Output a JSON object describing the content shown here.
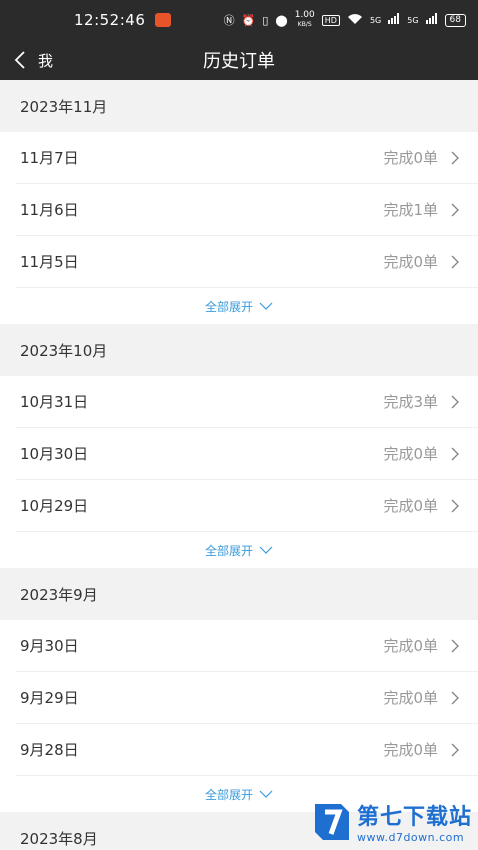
{
  "status_bar": {
    "time": "12:52:46",
    "speed": "1.00",
    "speed_unit": "KB/S",
    "hd": "HD",
    "signal1": "5G",
    "signal2": "5G",
    "battery": "68"
  },
  "nav": {
    "back_label": "我",
    "title": "历史订单"
  },
  "months": [
    {
      "label": "2023年11月",
      "days": [
        {
          "date": "11月7日",
          "count": "完成0单"
        },
        {
          "date": "11月6日",
          "count": "完成1单"
        },
        {
          "date": "11月5日",
          "count": "完成0单"
        }
      ],
      "expand_label": "全部展开"
    },
    {
      "label": "2023年10月",
      "days": [
        {
          "date": "10月31日",
          "count": "完成3单"
        },
        {
          "date": "10月30日",
          "count": "完成0单"
        },
        {
          "date": "10月29日",
          "count": "完成0单"
        }
      ],
      "expand_label": "全部展开"
    },
    {
      "label": "2023年9月",
      "days": [
        {
          "date": "9月30日",
          "count": "完成0单"
        },
        {
          "date": "9月29日",
          "count": "完成0单"
        },
        {
          "date": "9月28日",
          "count": "完成0单"
        }
      ],
      "expand_label": "全部展开"
    },
    {
      "label": "2023年8月"
    }
  ],
  "watermark": {
    "text": "第七下载站",
    "url": "www.d7down.com"
  },
  "colors": {
    "header_bg": "#2b2b2b",
    "accent_link": "#3a9bdc",
    "watermark_blue": "#1e6fd0"
  }
}
